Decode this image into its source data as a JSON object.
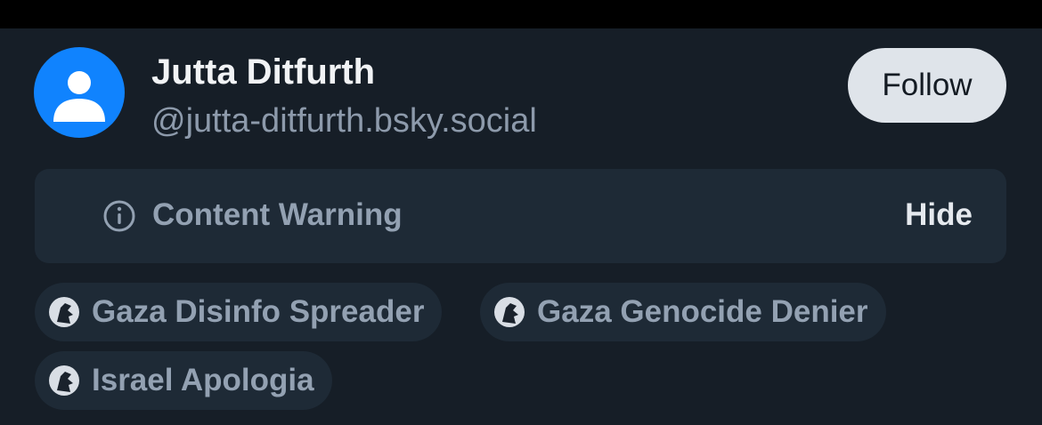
{
  "account": {
    "display_name": "Jutta Ditfurth",
    "handle": "@jutta-ditfurth.bsky.social",
    "avatar_icon": "default-avatar-icon",
    "avatar_color": "#1083fe"
  },
  "actions": {
    "follow_label": "Follow"
  },
  "content_warning": {
    "icon": "info-icon",
    "label": "Content Warning",
    "hide_label": "Hide"
  },
  "labels": [
    {
      "text": "Gaza Disinfo Spreader",
      "icon": "labeler-avatar-icon"
    },
    {
      "text": "Gaza Genocide Denier",
      "icon": "labeler-avatar-icon"
    },
    {
      "text": "Israel Apologia",
      "icon": "labeler-avatar-icon"
    }
  ]
}
